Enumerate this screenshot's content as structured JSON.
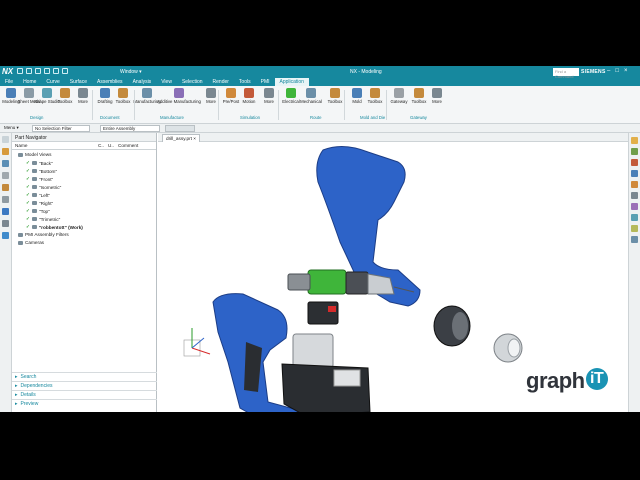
{
  "app": {
    "logo": "NX",
    "window_menu": "Window ▾",
    "title": "NX - Modeling",
    "search_placeholder": "Find a Command",
    "brand": "SIEMENS"
  },
  "menu": [
    "File",
    "Home",
    "Curve",
    "Surface",
    "Assemblies",
    "Analysis",
    "View",
    "Selection",
    "Render",
    "Tools",
    "PMI",
    "Application"
  ],
  "ribbon": {
    "buttons": [
      "Modeling",
      "Sheet Metal",
      "Shape Studio",
      "Toolbox",
      "More",
      "Drafting",
      "Toolbox",
      "Manufacturing",
      "Additive Manufacturing",
      "More",
      "Pre/Post",
      "Motion",
      "More",
      "Electrical",
      "Mechanical",
      "Toolbox",
      "Mold",
      "Toolbox",
      "Gateway",
      "Toolbox",
      "More"
    ],
    "groups": [
      "Design",
      "Document",
      "Manufacture",
      "Simulation",
      "Route",
      "Mold and Die",
      "Gateway"
    ]
  },
  "filters": {
    "menu": "Menu ▾",
    "selection_filter": "No Selection Filter",
    "scope": "Entire Assembly"
  },
  "part_navigator": {
    "title": "Part Navigator",
    "columns": [
      "Name",
      "C..",
      "U..",
      "Comment"
    ],
    "items": [
      "Model Views",
      "\"Back\"",
      "\"Bottom\"",
      "\"Front\"",
      "\"Isometric\"",
      "\"Left\"",
      "\"Right\"",
      "\"Top\"",
      "\"Trimetric\"",
      "\"robbentott\" (Work)",
      "PMI Assembly Filters",
      "Cameras"
    ],
    "sections": [
      "Search",
      "Dependencies",
      "Details",
      "Preview"
    ]
  },
  "doc_tab": "drill_assy.prt",
  "watermark": {
    "text": "graph",
    "accent": "iT"
  },
  "colors": {
    "accent": "#16889e",
    "blue_part": "#2d63c8",
    "green_part": "#3fb53a",
    "dark_part": "#3b3f45",
    "grey_part": "#cfd3d6"
  }
}
